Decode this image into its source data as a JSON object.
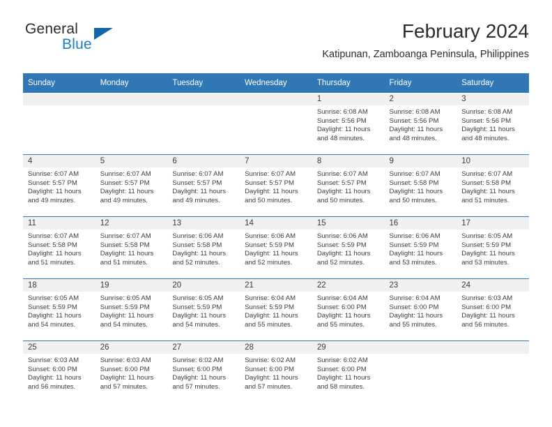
{
  "brand": {
    "name_part1": "General",
    "name_part2": "Blue",
    "accent_color": "#1f7bc1",
    "triangle_color": "#1565ab",
    "triangle_icon": "triangle-logo-icon"
  },
  "header": {
    "title": "February 2024",
    "subtitle": "Katipunan, Zamboanga Peninsula, Philippines"
  },
  "calendar": {
    "header_bg": "#3077b5",
    "header_text_color": "#ffffff",
    "daynum_band_bg": "#f0f0f0",
    "weekdays": [
      "Sunday",
      "Monday",
      "Tuesday",
      "Wednesday",
      "Thursday",
      "Friday",
      "Saturday"
    ],
    "weeks": [
      [
        {
          "day": "",
          "sunrise": "",
          "sunset": "",
          "daylight": "",
          "empty": true
        },
        {
          "day": "",
          "sunrise": "",
          "sunset": "",
          "daylight": "",
          "empty": true
        },
        {
          "day": "",
          "sunrise": "",
          "sunset": "",
          "daylight": "",
          "empty": true
        },
        {
          "day": "",
          "sunrise": "",
          "sunset": "",
          "daylight": "",
          "empty": true
        },
        {
          "day": "1",
          "sunrise": "Sunrise: 6:08 AM",
          "sunset": "Sunset: 5:56 PM",
          "daylight": "Daylight: 11 hours and 48 minutes.",
          "empty": false
        },
        {
          "day": "2",
          "sunrise": "Sunrise: 6:08 AM",
          "sunset": "Sunset: 5:56 PM",
          "daylight": "Daylight: 11 hours and 48 minutes.",
          "empty": false
        },
        {
          "day": "3",
          "sunrise": "Sunrise: 6:08 AM",
          "sunset": "Sunset: 5:56 PM",
          "daylight": "Daylight: 11 hours and 48 minutes.",
          "empty": false
        }
      ],
      [
        {
          "day": "4",
          "sunrise": "Sunrise: 6:07 AM",
          "sunset": "Sunset: 5:57 PM",
          "daylight": "Daylight: 11 hours and 49 minutes.",
          "empty": false
        },
        {
          "day": "5",
          "sunrise": "Sunrise: 6:07 AM",
          "sunset": "Sunset: 5:57 PM",
          "daylight": "Daylight: 11 hours and 49 minutes.",
          "empty": false
        },
        {
          "day": "6",
          "sunrise": "Sunrise: 6:07 AM",
          "sunset": "Sunset: 5:57 PM",
          "daylight": "Daylight: 11 hours and 49 minutes.",
          "empty": false
        },
        {
          "day": "7",
          "sunrise": "Sunrise: 6:07 AM",
          "sunset": "Sunset: 5:57 PM",
          "daylight": "Daylight: 11 hours and 50 minutes.",
          "empty": false
        },
        {
          "day": "8",
          "sunrise": "Sunrise: 6:07 AM",
          "sunset": "Sunset: 5:57 PM",
          "daylight": "Daylight: 11 hours and 50 minutes.",
          "empty": false
        },
        {
          "day": "9",
          "sunrise": "Sunrise: 6:07 AM",
          "sunset": "Sunset: 5:58 PM",
          "daylight": "Daylight: 11 hours and 50 minutes.",
          "empty": false
        },
        {
          "day": "10",
          "sunrise": "Sunrise: 6:07 AM",
          "sunset": "Sunset: 5:58 PM",
          "daylight": "Daylight: 11 hours and 51 minutes.",
          "empty": false
        }
      ],
      [
        {
          "day": "11",
          "sunrise": "Sunrise: 6:07 AM",
          "sunset": "Sunset: 5:58 PM",
          "daylight": "Daylight: 11 hours and 51 minutes.",
          "empty": false
        },
        {
          "day": "12",
          "sunrise": "Sunrise: 6:07 AM",
          "sunset": "Sunset: 5:58 PM",
          "daylight": "Daylight: 11 hours and 51 minutes.",
          "empty": false
        },
        {
          "day": "13",
          "sunrise": "Sunrise: 6:06 AM",
          "sunset": "Sunset: 5:58 PM",
          "daylight": "Daylight: 11 hours and 52 minutes.",
          "empty": false
        },
        {
          "day": "14",
          "sunrise": "Sunrise: 6:06 AM",
          "sunset": "Sunset: 5:59 PM",
          "daylight": "Daylight: 11 hours and 52 minutes.",
          "empty": false
        },
        {
          "day": "15",
          "sunrise": "Sunrise: 6:06 AM",
          "sunset": "Sunset: 5:59 PM",
          "daylight": "Daylight: 11 hours and 52 minutes.",
          "empty": false
        },
        {
          "day": "16",
          "sunrise": "Sunrise: 6:06 AM",
          "sunset": "Sunset: 5:59 PM",
          "daylight": "Daylight: 11 hours and 53 minutes.",
          "empty": false
        },
        {
          "day": "17",
          "sunrise": "Sunrise: 6:05 AM",
          "sunset": "Sunset: 5:59 PM",
          "daylight": "Daylight: 11 hours and 53 minutes.",
          "empty": false
        }
      ],
      [
        {
          "day": "18",
          "sunrise": "Sunrise: 6:05 AM",
          "sunset": "Sunset: 5:59 PM",
          "daylight": "Daylight: 11 hours and 54 minutes.",
          "empty": false
        },
        {
          "day": "19",
          "sunrise": "Sunrise: 6:05 AM",
          "sunset": "Sunset: 5:59 PM",
          "daylight": "Daylight: 11 hours and 54 minutes.",
          "empty": false
        },
        {
          "day": "20",
          "sunrise": "Sunrise: 6:05 AM",
          "sunset": "Sunset: 5:59 PM",
          "daylight": "Daylight: 11 hours and 54 minutes.",
          "empty": false
        },
        {
          "day": "21",
          "sunrise": "Sunrise: 6:04 AM",
          "sunset": "Sunset: 5:59 PM",
          "daylight": "Daylight: 11 hours and 55 minutes.",
          "empty": false
        },
        {
          "day": "22",
          "sunrise": "Sunrise: 6:04 AM",
          "sunset": "Sunset: 6:00 PM",
          "daylight": "Daylight: 11 hours and 55 minutes.",
          "empty": false
        },
        {
          "day": "23",
          "sunrise": "Sunrise: 6:04 AM",
          "sunset": "Sunset: 6:00 PM",
          "daylight": "Daylight: 11 hours and 55 minutes.",
          "empty": false
        },
        {
          "day": "24",
          "sunrise": "Sunrise: 6:03 AM",
          "sunset": "Sunset: 6:00 PM",
          "daylight": "Daylight: 11 hours and 56 minutes.",
          "empty": false
        }
      ],
      [
        {
          "day": "25",
          "sunrise": "Sunrise: 6:03 AM",
          "sunset": "Sunset: 6:00 PM",
          "daylight": "Daylight: 11 hours and 56 minutes.",
          "empty": false
        },
        {
          "day": "26",
          "sunrise": "Sunrise: 6:03 AM",
          "sunset": "Sunset: 6:00 PM",
          "daylight": "Daylight: 11 hours and 57 minutes.",
          "empty": false
        },
        {
          "day": "27",
          "sunrise": "Sunrise: 6:02 AM",
          "sunset": "Sunset: 6:00 PM",
          "daylight": "Daylight: 11 hours and 57 minutes.",
          "empty": false
        },
        {
          "day": "28",
          "sunrise": "Sunrise: 6:02 AM",
          "sunset": "Sunset: 6:00 PM",
          "daylight": "Daylight: 11 hours and 57 minutes.",
          "empty": false
        },
        {
          "day": "29",
          "sunrise": "Sunrise: 6:02 AM",
          "sunset": "Sunset: 6:00 PM",
          "daylight": "Daylight: 11 hours and 58 minutes.",
          "empty": false
        },
        {
          "day": "",
          "sunrise": "",
          "sunset": "",
          "daylight": "",
          "empty": true
        },
        {
          "day": "",
          "sunrise": "",
          "sunset": "",
          "daylight": "",
          "empty": true
        }
      ]
    ]
  }
}
